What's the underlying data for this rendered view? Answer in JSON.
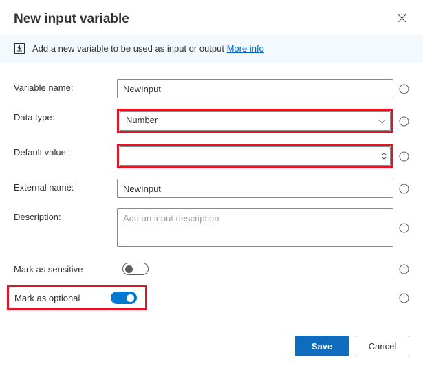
{
  "header": {
    "title": "New input variable"
  },
  "banner": {
    "text": "Add a new variable to be used as input or output",
    "link_text": "More info"
  },
  "fields": {
    "variable_name": {
      "label": "Variable name:",
      "value": "NewInput"
    },
    "data_type": {
      "label": "Data type:",
      "value": "Number"
    },
    "default_value": {
      "label": "Default value:",
      "value": ""
    },
    "external_name": {
      "label": "External name:",
      "value": "NewInput"
    },
    "description": {
      "label": "Description:",
      "placeholder": "Add an input description"
    },
    "mark_sensitive": {
      "label": "Mark as sensitive",
      "on": false
    },
    "mark_optional": {
      "label": "Mark as optional",
      "on": true
    }
  },
  "footer": {
    "save": "Save",
    "cancel": "Cancel"
  }
}
